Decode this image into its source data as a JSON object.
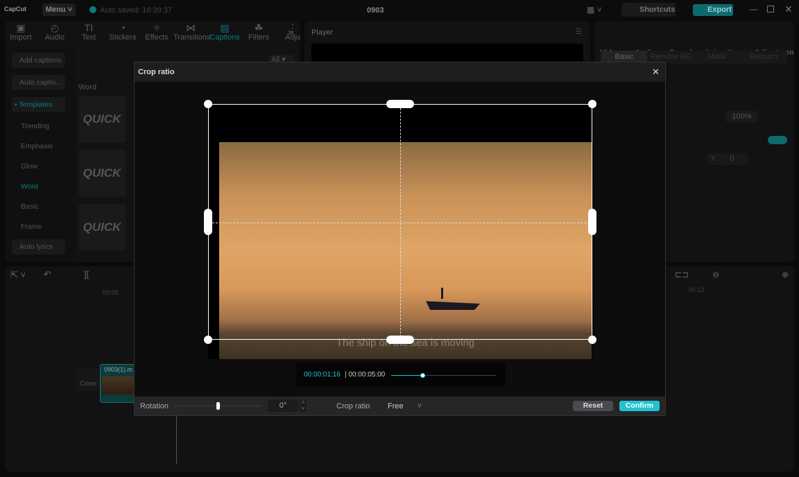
{
  "app": {
    "logo": "CapCut",
    "menu": "Menu",
    "autosave": "Auto saved: 16:39:37",
    "project": "0903",
    "shortcuts": "Shortcuts",
    "export": "Export"
  },
  "tabs": [
    {
      "label": "Import",
      "icon": "import-icon"
    },
    {
      "label": "Audio",
      "icon": "audio-icon"
    },
    {
      "label": "Text",
      "icon": "text-icon"
    },
    {
      "label": "Stickers",
      "icon": "sticker-icon"
    },
    {
      "label": "Effects",
      "icon": "effects-icon"
    },
    {
      "label": "Transitions",
      "icon": "transitions-icon"
    },
    {
      "label": "Captions",
      "icon": "captions-icon",
      "active": true
    },
    {
      "label": "Filters",
      "icon": "filters-icon"
    },
    {
      "label": "Adju",
      "icon": "adjust-icon"
    }
  ],
  "captions_side": {
    "add": "Add captions",
    "auto": "Auto captio...",
    "templates": "• Templates",
    "items": [
      "Trending",
      "Emphasis",
      "Glow",
      "Word",
      "Basic",
      "Frame"
    ],
    "lyrics": "Auto lyrics",
    "active": "Word"
  },
  "filter": "All",
  "section": "Word",
  "thumbs": [
    "QUICK",
    "QUICK",
    "QUICK"
  ],
  "player": {
    "title": "Player"
  },
  "right": {
    "tabs": [
      "Video",
      "Audio",
      "Speed",
      "Animation",
      "Adjustmen"
    ],
    "subtabs": [
      "Basic",
      "Remove BG",
      "Mask",
      "Retouch"
    ],
    "scale": "100%",
    "y_label": "Y",
    "y_value": "0"
  },
  "timeline": {
    "ruler_start": "00:00",
    "ruler_mark": "00:12",
    "clip": "0903(1).m",
    "cover": "Cover"
  },
  "crop": {
    "title": "Crop ratio",
    "caption": "The ship on the sea is moving",
    "time_current": "00:00:01:16",
    "time_total": "00:00:05:00",
    "progress": 0.3,
    "rotation_label": "Rotation",
    "rotation_value": "0°",
    "rotation_slider": 0.5,
    "ratio_label": "Crop ratio",
    "ratio_value": "Free",
    "reset": "Reset",
    "confirm": "Confirm"
  },
  "colors": {
    "accent": "#1ec8d6",
    "export": "#0e6a6e",
    "confirm": "#22c2d2"
  }
}
